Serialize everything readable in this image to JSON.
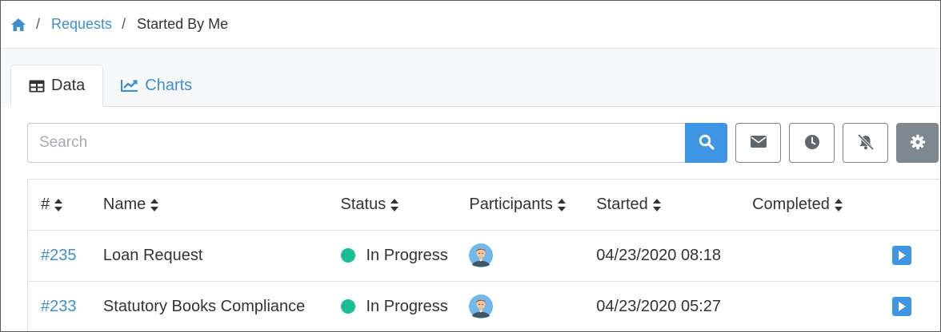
{
  "breadcrumb": {
    "home_icon": "home-icon",
    "separator": "/",
    "items": [
      {
        "label": "Requests"
      },
      {
        "label": "Started By Me"
      }
    ]
  },
  "tabs": [
    {
      "label": "Data",
      "icon": "table-icon",
      "active": true
    },
    {
      "label": "Charts",
      "icon": "line-chart-icon",
      "active": false
    }
  ],
  "search": {
    "placeholder": "Search",
    "value": ""
  },
  "toolbar": {
    "buttons": [
      "search-icon",
      "envelope-icon",
      "clock-icon",
      "bell-slash-icon",
      "gear-icon"
    ]
  },
  "table": {
    "columns": [
      "#",
      "Name",
      "Status",
      "Participants",
      "Started",
      "Completed"
    ],
    "rows": [
      {
        "id": "#235",
        "name": "Loan Request",
        "status": "In Progress",
        "started": "04/23/2020 08:18",
        "completed": ""
      },
      {
        "id": "#233",
        "name": "Statutory Books Compliance",
        "status": "In Progress",
        "started": "04/23/2020 05:27",
        "completed": ""
      }
    ]
  },
  "colors": {
    "accent": "#3d95e3",
    "link": "#3d8fd1",
    "status_in_progress": "#1bbc95",
    "settings_button": "#7d8891"
  }
}
